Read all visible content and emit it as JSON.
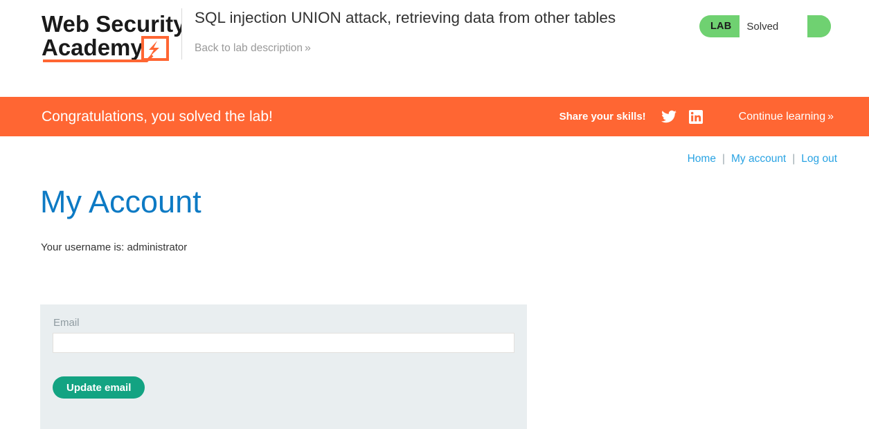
{
  "header": {
    "logo": {
      "line1": "Web Security",
      "line2": "Academy",
      "icon": "lightning-bolt-icon"
    },
    "lab_title": "SQL injection UNION attack, retrieving data from other tables",
    "back_link": "Back to lab description",
    "back_link_chevron": "»",
    "lab_status": {
      "tag": "LAB",
      "value": "Solved"
    }
  },
  "banner": {
    "message": "Congratulations, you solved the lab!",
    "share_label": "Share your skills!",
    "social": [
      {
        "name": "twitter-icon"
      },
      {
        "name": "linkedin-icon"
      }
    ],
    "continue_label": "Continue learning",
    "continue_chevron": "»"
  },
  "account_nav": {
    "items": [
      {
        "label": "Home"
      },
      {
        "label": "My account"
      },
      {
        "label": "Log out"
      }
    ],
    "separator": "|"
  },
  "main": {
    "title": "My Account",
    "username_line": "Your username is: administrator",
    "form": {
      "email_label": "Email",
      "email_value": "",
      "email_placeholder": "",
      "submit_label": "Update email"
    }
  },
  "colors": {
    "banner_orange": "#ff6633",
    "accent_blue": "#0d7ac4",
    "link_blue": "#29a3e3",
    "status_green": "#6fd171",
    "button_teal": "#13a382",
    "panel_grey": "#e9eef0",
    "logo_orange": "#ff6633"
  }
}
